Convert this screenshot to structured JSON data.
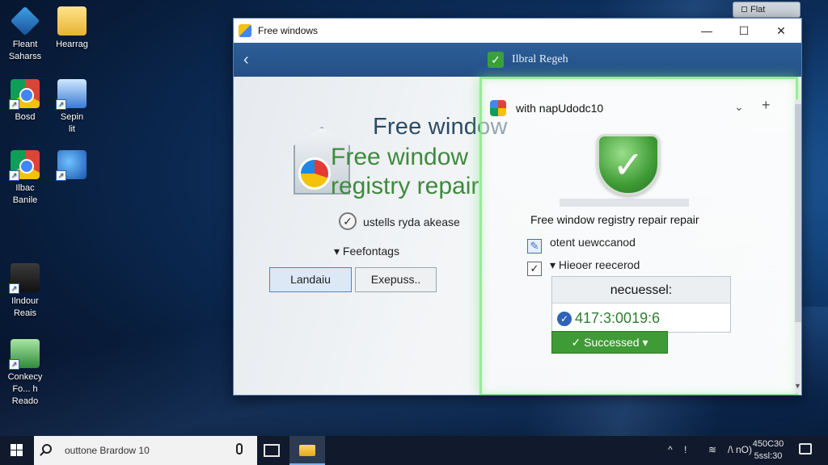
{
  "desktop": {
    "icons": [
      {
        "label_line1": "Fleant",
        "label_line2": "Saharss",
        "icon": "shield-app-icon"
      },
      {
        "label_line1": "Hearrag",
        "label_line2": "",
        "icon": "folder-icon"
      },
      {
        "label_line1": "Bosd",
        "label_line2": "",
        "icon": "chrome-icon"
      },
      {
        "label_line1": "Sepin",
        "label_line2": "lit",
        "icon": "photo-icon"
      },
      {
        "label_line1": "Ilbac",
        "label_line2": "Banile",
        "icon": "chrome-icon"
      },
      {
        "label_line1": "",
        "label_line2": "",
        "icon": "globe-app-icon"
      },
      {
        "label_line1": "Ilndour",
        "label_line2": "Reais",
        "icon": "document-icon"
      },
      {
        "label_line1": "Conkecy",
        "label_line2": "Fo... h",
        "label_line3": "Reado",
        "icon": "database-icon"
      }
    ],
    "mini_window_title": "Flat"
  },
  "window": {
    "title": "Free windows",
    "minimize": "—",
    "maximize": "☐",
    "close": "✕",
    "header_back": "‹",
    "header_title": "Ilbral Regeh"
  },
  "left_panel": {
    "title_line1": "Free window",
    "title_line2": "Free window registry repair",
    "checkbox_label": "ustells ryda akease",
    "expander_label": "Feefontags",
    "button_primary": "Landaiu",
    "button_secondary": "Exepuss.."
  },
  "right_panel": {
    "title": "with napUdodc10",
    "heading": "Free window registry repair repair",
    "item1": "otent uewccanod",
    "item2": "Hieoer reecerod",
    "result_label": "necuessel:",
    "result_value": "417:3:0019:6",
    "success_button": "Successed"
  },
  "taskbar": {
    "search_text": "outtone Brardow 10",
    "tray_text": "/\\ nO)",
    "clock_line1": "450C30",
    "clock_line2": "5ssl:30"
  },
  "colors": {
    "accent_green": "#3f9b35",
    "header_blue": "#2c5f98",
    "desktop_bg": "#0c2c57"
  }
}
